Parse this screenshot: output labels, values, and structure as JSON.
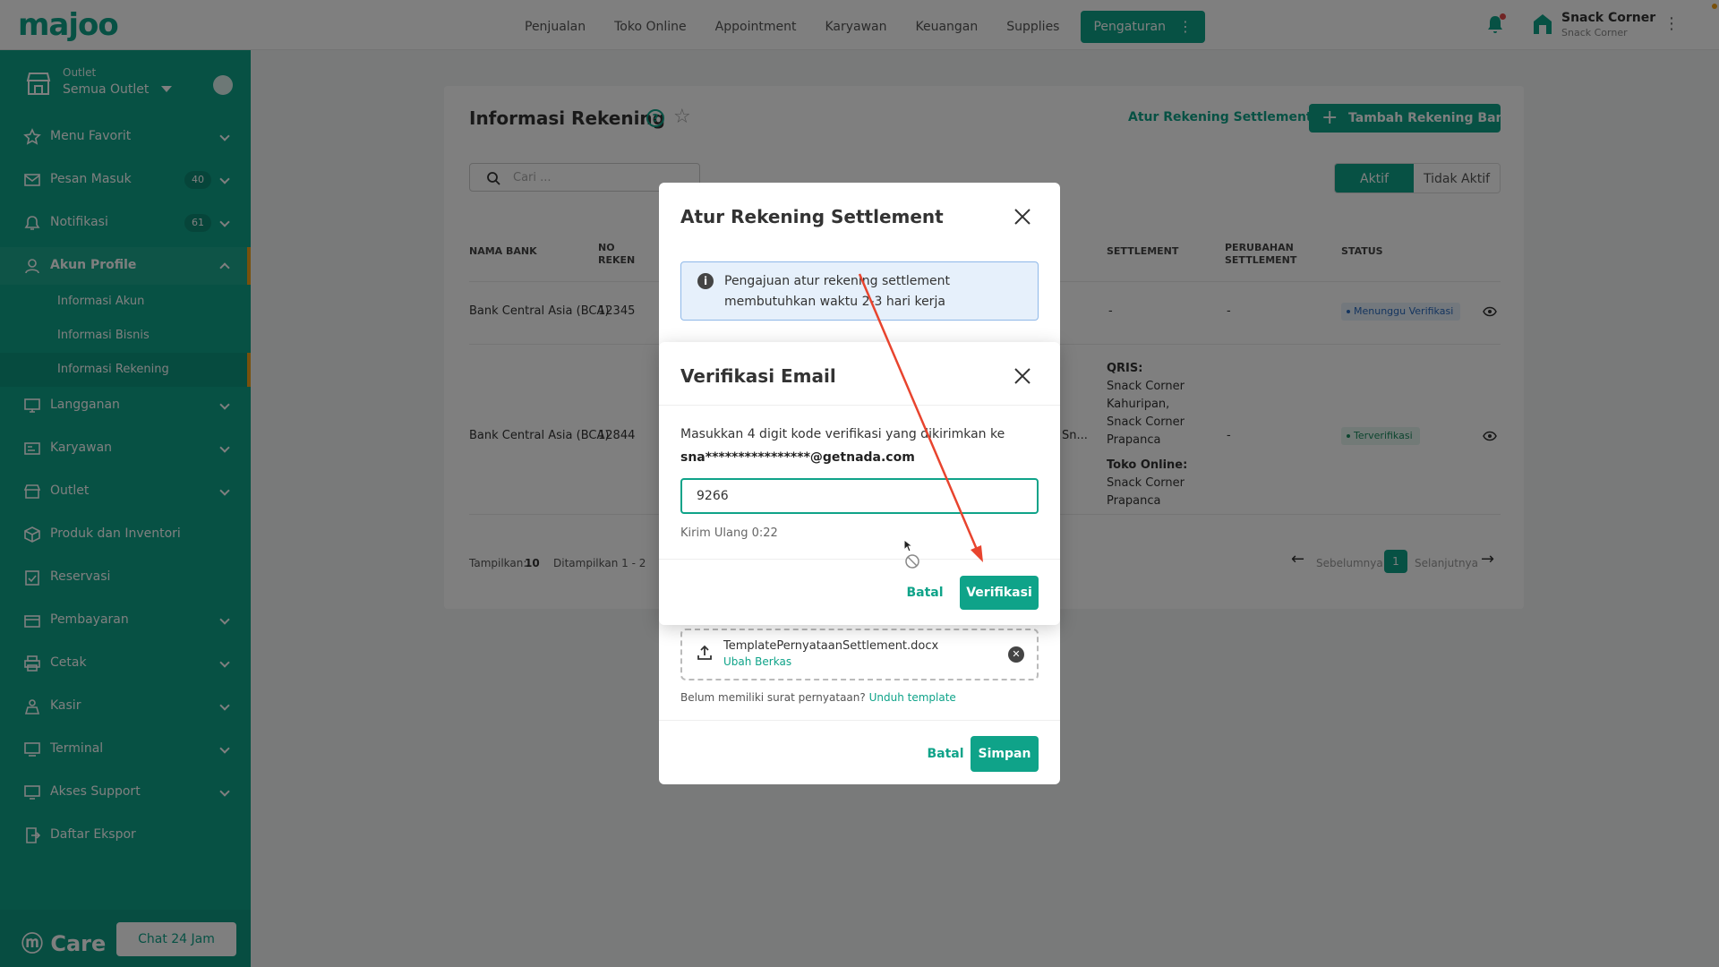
{
  "header": {
    "logo": "majoo",
    "nav": [
      "Penjualan",
      "Toko Online",
      "Appointment",
      "Karyawan",
      "Keuangan",
      "Supplies"
    ],
    "nav_active": "Pengaturan",
    "user_name": "Snack Corner",
    "user_sub": "Snack Corner"
  },
  "sidebar": {
    "outlet_label": "Outlet",
    "outlet_value": "Semua Outlet",
    "items": [
      {
        "label": "Menu Favorit",
        "icon": "star-icon"
      },
      {
        "label": "Pesan Masuk",
        "badge": "40",
        "icon": "mail-icon"
      },
      {
        "label": "Notifikasi",
        "badge": "61",
        "icon": "bell-icon"
      },
      {
        "label": "Akun Profile",
        "icon": "user-icon"
      },
      {
        "label": "Langganan",
        "icon": "monitor-icon"
      },
      {
        "label": "Karyawan",
        "icon": "id-card-icon"
      },
      {
        "label": "Outlet",
        "icon": "store-icon"
      },
      {
        "label": "Produk dan Inventori",
        "icon": "box-icon"
      },
      {
        "label": "Reservasi",
        "icon": "calendar-check-icon"
      },
      {
        "label": "Pembayaran",
        "icon": "wallet-icon"
      },
      {
        "label": "Cetak",
        "icon": "printer-icon"
      },
      {
        "label": "Kasir",
        "icon": "cashier-icon"
      },
      {
        "label": "Terminal",
        "icon": "terminal-icon"
      },
      {
        "label": "Akses Support",
        "icon": "support-monitor-icon"
      },
      {
        "label": "Daftar Ekspor",
        "icon": "export-icon"
      }
    ],
    "sub_items": [
      "Informasi Akun",
      "Informasi Bisnis",
      "Informasi Rekening"
    ],
    "care_logo": "Care",
    "chat_label": "Chat 24 Jam"
  },
  "page": {
    "title": "Informasi Rekening",
    "link_settlement": "Atur Rekening Settlement",
    "add_button": "Tambah Rekening Bank",
    "search_placeholder": "Cari ...",
    "toggle_active": "Aktif",
    "toggle_inactive": "Tidak Aktif",
    "columns": {
      "bank": "NAMA BANK",
      "no_line1": "NO",
      "no_line2": "REKEN",
      "settlement": "SETTLEMENT",
      "change_line1": "PERUBAHAN",
      "change_line2": "SETTLEMENT",
      "status": "STATUS"
    },
    "rows": [
      {
        "bank": "Bank Central Asia (BCA)",
        "no": "12345",
        "settlement": "-",
        "change": "-",
        "status": "Menunggu Verifikasi"
      },
      {
        "bank": "Bank Central Asia (BCA)",
        "no": "12844",
        "col_mid": "Sn...",
        "settlement_qris_label": "QRIS:",
        "settlement_qris_lines": [
          "Snack Corner",
          "Kahuripan,",
          "Snack Corner",
          "Prapanca"
        ],
        "settlement_toko_label": "Toko Online:",
        "settlement_toko_lines": [
          "Snack Corner",
          "Prapanca"
        ],
        "change": "-",
        "status": "Terverifikasi"
      }
    ],
    "pager": {
      "show_label": "Tampilkan:",
      "show_value": "10",
      "showing": "Ditampilkan 1 - 2",
      "prev": "Sebelumnya",
      "current": "1",
      "next": "Selanjutnya"
    }
  },
  "modal_settlement": {
    "title": "Atur Rekening Settlement",
    "info": "Pengajuan atur rekening settlement membutuhkan waktu 2-3 hari kerja",
    "file_name": "TemplatePernyataanSettlement.docx",
    "change_file": "Ubah Berkas",
    "hint": "Belum memiliki surat pernyataan?",
    "hint_link": "Unduh template",
    "cancel": "Batal",
    "save": "Simpan"
  },
  "modal_verify": {
    "title": "Verifikasi Email",
    "description": "Masukkan 4 digit kode verifikasi yang dikirimkan ke",
    "email": "sna****************@getnada.com",
    "code_value": "9266",
    "resend": "Kirim Ulang 0:22",
    "cancel": "Batal",
    "verify": "Verifikasi"
  },
  "colors": {
    "brand": "#0fa389",
    "accent": "#f2a21a",
    "annotation_arrow": "#e8442e"
  }
}
